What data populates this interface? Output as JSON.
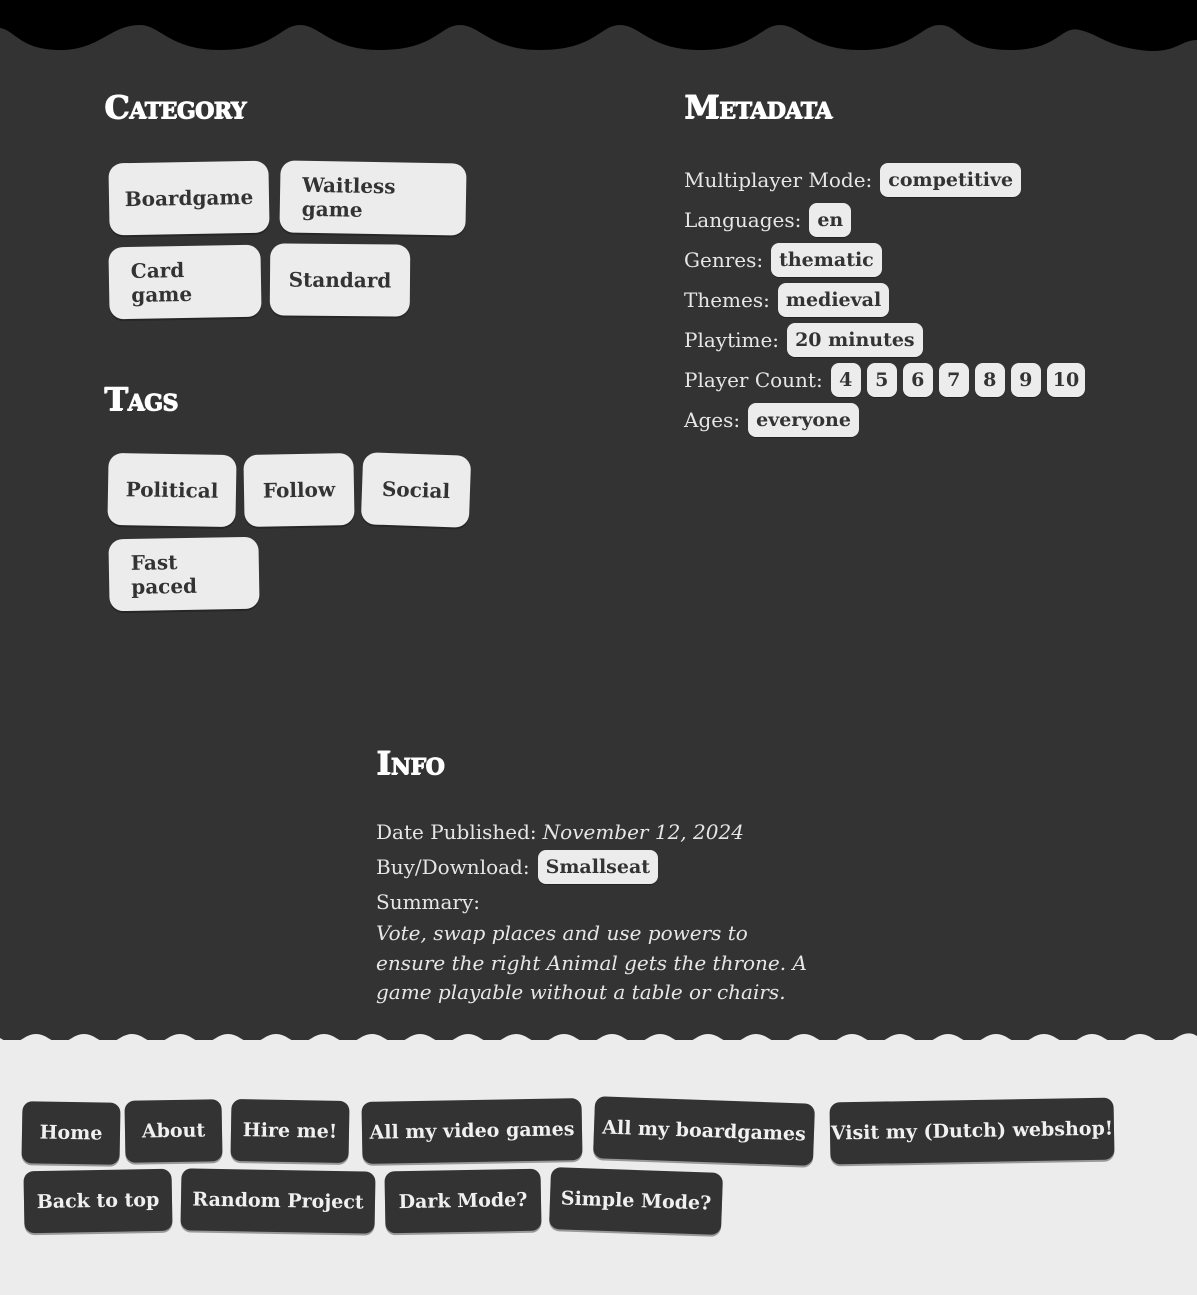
{
  "category": {
    "title": "Category",
    "items": [
      "Boardgame",
      "Waitless game",
      "Card game",
      "Standard"
    ]
  },
  "tags": {
    "title": "Tags",
    "items": [
      "Political",
      "Follow",
      "Social",
      "Fast paced"
    ]
  },
  "metadata": {
    "title": "Metadata",
    "multiplayer_label": "Multiplayer Mode:",
    "multiplayer_value": "competitive",
    "languages_label": "Languages:",
    "languages_value": "en",
    "genres_label": "Genres:",
    "genres_value": "thematic",
    "themes_label": "Themes:",
    "themes_value": "medieval",
    "playtime_label": "Playtime:",
    "playtime_value": "20 minutes",
    "player_count_label": "Player Count:",
    "player_counts": [
      "4",
      "5",
      "6",
      "7",
      "8",
      "9",
      "10"
    ],
    "ages_label": "Ages:",
    "ages_value": "everyone"
  },
  "info": {
    "title": "Info",
    "date_label": "Date Published:",
    "date_value": "November 12, 2024",
    "buy_label": "Buy/Download:",
    "buy_value": "Smallseat",
    "summary_label": "Summary:",
    "summary_text": "Vote, swap places and use powers to ensure the right Animal gets the throne. A game playable without a table or chairs."
  },
  "footer_nav": {
    "home": "Home",
    "about": "About",
    "hire": "Hire me!",
    "video_games": "All my video games",
    "boardgames": "All my boardgames",
    "webshop": "Visit my (Dutch) webshop!",
    "back_to_top": "Back to top",
    "random": "Random Project",
    "dark_mode": "Dark Mode?",
    "simple_mode": "Simple Mode?"
  },
  "colors": {
    "dark_bg": "#333333",
    "light_bg": "#ececec",
    "top_band": "#000000"
  }
}
